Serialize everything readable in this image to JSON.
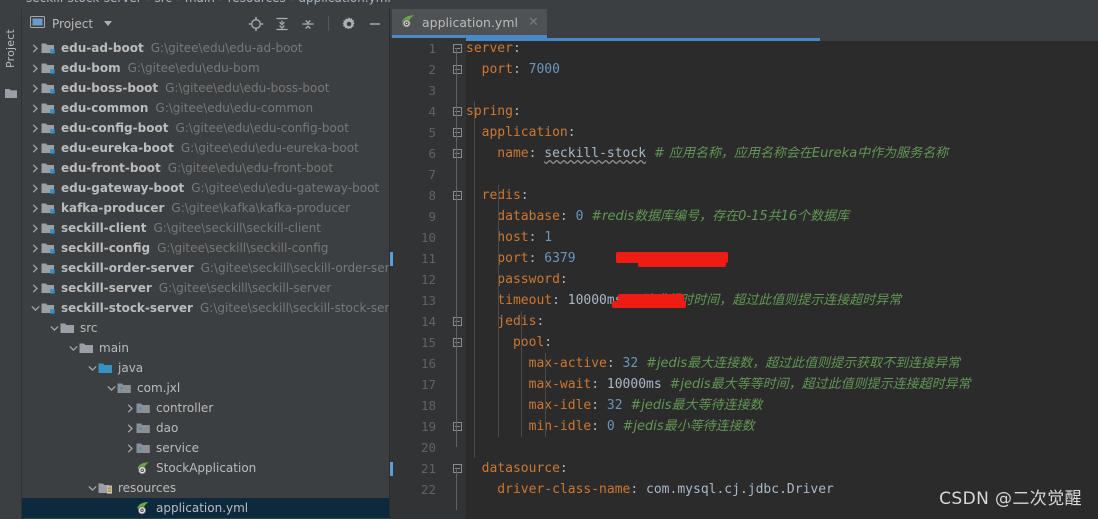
{
  "breadcrumb": {
    "items": [
      "seckill-stock-server",
      "src",
      "main",
      "resources"
    ],
    "file": "application.yml",
    "separator": "›"
  },
  "tool_strip": {
    "project_tab_label": "Project",
    "project_icon": "folder-icon"
  },
  "project_panel": {
    "title": "Project",
    "title_icon": "project-view-icon",
    "dropdown_icon": "chevron-down-icon",
    "tools": [
      {
        "name": "locate-icon",
        "label": "Select Opened File"
      },
      {
        "name": "expand-all-icon",
        "label": "Expand All"
      },
      {
        "name": "collapse-all-icon",
        "label": "Collapse All"
      },
      {
        "name": "gear-icon",
        "label": "Settings"
      },
      {
        "name": "minimize-icon",
        "label": "Hide"
      }
    ]
  },
  "tree": [
    {
      "indent": 0,
      "arrow": "right",
      "icon": "module-icon",
      "name": "edu-ad-boot",
      "path": "G:\\gitee\\edu\\edu-ad-boot",
      "bold": true
    },
    {
      "indent": 0,
      "arrow": "right",
      "icon": "module-icon",
      "name": "edu-bom",
      "path": "G:\\gitee\\edu\\edu-bom",
      "bold": true
    },
    {
      "indent": 0,
      "arrow": "right",
      "icon": "module-icon",
      "name": "edu-boss-boot",
      "path": "G:\\gitee\\edu\\edu-boss-boot",
      "bold": true
    },
    {
      "indent": 0,
      "arrow": "right",
      "icon": "module-icon",
      "name": "edu-common",
      "path": "G:\\gitee\\edu\\edu-common",
      "bold": true
    },
    {
      "indent": 0,
      "arrow": "right",
      "icon": "module-icon",
      "name": "edu-config-boot",
      "path": "G:\\gitee\\edu\\edu-config-boot",
      "bold": true
    },
    {
      "indent": 0,
      "arrow": "right",
      "icon": "module-icon",
      "name": "edu-eureka-boot",
      "path": "G:\\gitee\\edu\\edu-eureka-boot",
      "bold": true
    },
    {
      "indent": 0,
      "arrow": "right",
      "icon": "module-icon",
      "name": "edu-front-boot",
      "path": "G:\\gitee\\edu\\edu-front-boot",
      "bold": true
    },
    {
      "indent": 0,
      "arrow": "right",
      "icon": "module-icon",
      "name": "edu-gateway-boot",
      "path": "G:\\gitee\\edu\\edu-gateway-boot",
      "bold": true
    },
    {
      "indent": 0,
      "arrow": "right",
      "icon": "module-icon",
      "name": "kafka-producer",
      "path": "G:\\gitee\\kafka\\kafka-producer",
      "bold": true
    },
    {
      "indent": 0,
      "arrow": "right",
      "icon": "module-icon",
      "name": "seckill-client",
      "path": "G:\\gitee\\seckill\\seckill-client",
      "bold": true
    },
    {
      "indent": 0,
      "arrow": "right",
      "icon": "module-icon",
      "name": "seckill-config",
      "path": "G:\\gitee\\seckill\\seckill-config",
      "bold": true
    },
    {
      "indent": 0,
      "arrow": "right",
      "icon": "module-icon",
      "name": "seckill-order-server",
      "path": "G:\\gitee\\seckill\\seckill-order-server",
      "bold": true
    },
    {
      "indent": 0,
      "arrow": "right",
      "icon": "module-icon",
      "name": "seckill-server",
      "path": "G:\\gitee\\seckill\\seckill-server",
      "bold": true
    },
    {
      "indent": 0,
      "arrow": "down",
      "icon": "module-icon",
      "name": "seckill-stock-server",
      "path": "G:\\gitee\\seckill\\seckill-stock-server",
      "bold": true
    },
    {
      "indent": 1,
      "arrow": "down",
      "icon": "folder-icon",
      "name": "src",
      "path": "",
      "bold": false
    },
    {
      "indent": 2,
      "arrow": "down",
      "icon": "folder-icon",
      "name": "main",
      "path": "",
      "bold": false
    },
    {
      "indent": 3,
      "arrow": "down",
      "icon": "source-folder-icon",
      "name": "java",
      "path": "",
      "bold": false
    },
    {
      "indent": 4,
      "arrow": "down",
      "icon": "package-icon",
      "name": "com.jxl",
      "path": "",
      "bold": false
    },
    {
      "indent": 5,
      "arrow": "right",
      "icon": "package-icon",
      "name": "controller",
      "path": "",
      "bold": false
    },
    {
      "indent": 5,
      "arrow": "right",
      "icon": "package-icon",
      "name": "dao",
      "path": "",
      "bold": false
    },
    {
      "indent": 5,
      "arrow": "right",
      "icon": "package-icon",
      "name": "service",
      "path": "",
      "bold": false
    },
    {
      "indent": 5,
      "arrow": "none",
      "icon": "spring-class-icon",
      "name": "StockApplication",
      "path": "",
      "bold": false
    },
    {
      "indent": 3,
      "arrow": "down",
      "icon": "resources-folder-icon",
      "name": "resources",
      "path": "",
      "bold": false
    },
    {
      "indent": 5,
      "arrow": "none",
      "icon": "yml-spring-icon",
      "name": "application.yml",
      "path": "",
      "bold": false,
      "selected": true
    }
  ],
  "editor": {
    "tab": {
      "label": "application.yml",
      "icon": "yml-spring-icon",
      "close_icon": "close-icon"
    },
    "lines": [
      {
        "n": "1",
        "fold": "start",
        "segs": [
          {
            "t": "server",
            "c": "k"
          },
          {
            "t": ":",
            "c": "kk"
          }
        ]
      },
      {
        "n": "2",
        "fold": "end",
        "indent": 1,
        "segs": [
          {
            "t": "  port",
            "c": "k"
          },
          {
            "t": ": ",
            "c": "kk"
          },
          {
            "t": "7000",
            "c": "num"
          }
        ]
      },
      {
        "n": "3",
        "fold": "none",
        "segs": []
      },
      {
        "n": "4",
        "fold": "start",
        "segs": [
          {
            "t": "spring",
            "c": "k"
          },
          {
            "t": ":",
            "c": "kk"
          }
        ]
      },
      {
        "n": "5",
        "fold": "start",
        "indent": 1,
        "segs": [
          {
            "t": "  application",
            "c": "k"
          },
          {
            "t": ":",
            "c": "kk"
          }
        ]
      },
      {
        "n": "6",
        "fold": "end",
        "indent": 2,
        "segs": [
          {
            "t": "    name",
            "c": "k"
          },
          {
            "t": ": ",
            "c": "kk"
          },
          {
            "t": "seckill-stock",
            "c": "val",
            "squiggle": true
          },
          {
            "t": " ",
            "c": "kk"
          },
          {
            "t": "# 应用名称，应用名称会在Eureka中作为服务名称",
            "c": "cmx"
          }
        ]
      },
      {
        "n": "7",
        "fold": "none",
        "segs": []
      },
      {
        "n": "8",
        "fold": "start",
        "indent": 1,
        "segs": [
          {
            "t": "  redis",
            "c": "k"
          },
          {
            "t": ":",
            "c": "kk"
          }
        ]
      },
      {
        "n": "9",
        "fold": "none",
        "indent": 2,
        "segs": [
          {
            "t": "    database",
            "c": "k"
          },
          {
            "t": ": ",
            "c": "kk"
          },
          {
            "t": "0",
            "c": "num"
          },
          {
            "t": " ",
            "c": "kk"
          },
          {
            "t": "#redis数据库编号，存在0-15共16个数据库",
            "c": "cmx"
          }
        ]
      },
      {
        "n": "10",
        "fold": "none",
        "indent": 2,
        "segs": [
          {
            "t": "    host",
            "c": "k"
          },
          {
            "t": ": ",
            "c": "kk"
          },
          {
            "t": "1",
            "c": "num"
          }
        ],
        "redacted": "host"
      },
      {
        "n": "11",
        "fold": "none",
        "indent": 2,
        "segs": [
          {
            "t": "    port",
            "c": "k"
          },
          {
            "t": ": ",
            "c": "kk"
          },
          {
            "t": "6379",
            "c": "num"
          }
        ]
      },
      {
        "n": "12",
        "fold": "none",
        "indent": 2,
        "segs": [
          {
            "t": "    password",
            "c": "k"
          },
          {
            "t": ": ",
            "c": "kk"
          }
        ],
        "redacted": "password"
      },
      {
        "n": "13",
        "fold": "none",
        "indent": 2,
        "segs": [
          {
            "t": "    timeout",
            "c": "k"
          },
          {
            "t": ": ",
            "c": "kk"
          },
          {
            "t": "10000ms",
            "c": "val"
          },
          {
            "t": " ",
            "c": "kk"
          },
          {
            "t": "#请求超时时间，超过此值则提示连接超时异常",
            "c": "cmx"
          }
        ]
      },
      {
        "n": "14",
        "fold": "start",
        "indent": 2,
        "segs": [
          {
            "t": "    jedis",
            "c": "k"
          },
          {
            "t": ":",
            "c": "kk"
          }
        ]
      },
      {
        "n": "15",
        "fold": "start",
        "indent": 3,
        "segs": [
          {
            "t": "      pool",
            "c": "k"
          },
          {
            "t": ":",
            "c": "kk"
          }
        ]
      },
      {
        "n": "16",
        "fold": "none",
        "indent": 4,
        "segs": [
          {
            "t": "        max-active",
            "c": "k"
          },
          {
            "t": ": ",
            "c": "kk"
          },
          {
            "t": "32",
            "c": "num"
          },
          {
            "t": " ",
            "c": "kk"
          },
          {
            "t": "#jedis最大连接数，超过此值则提示获取不到连接异常",
            "c": "cmx"
          }
        ]
      },
      {
        "n": "17",
        "fold": "none",
        "indent": 4,
        "segs": [
          {
            "t": "        max-wait",
            "c": "k"
          },
          {
            "t": ": ",
            "c": "kk"
          },
          {
            "t": "10000ms",
            "c": "val"
          },
          {
            "t": " ",
            "c": "kk"
          },
          {
            "t": "#jedis最大等等时间，超过此值则提示连接超时异常",
            "c": "cmx"
          }
        ]
      },
      {
        "n": "18",
        "fold": "none",
        "indent": 4,
        "segs": [
          {
            "t": "        max-idle",
            "c": "k"
          },
          {
            "t": ": ",
            "c": "kk"
          },
          {
            "t": "32",
            "c": "num"
          },
          {
            "t": " ",
            "c": "kk"
          },
          {
            "t": "#jedis最大等待连接数",
            "c": "cmx"
          }
        ]
      },
      {
        "n": "19",
        "fold": "end",
        "indent": 4,
        "segs": [
          {
            "t": "        min-idle",
            "c": "k"
          },
          {
            "t": ": ",
            "c": "kk"
          },
          {
            "t": "0",
            "c": "num"
          },
          {
            "t": " ",
            "c": "kk"
          },
          {
            "t": "#jedis最小等待连接数",
            "c": "cmx"
          }
        ]
      },
      {
        "n": "20",
        "fold": "none",
        "segs": []
      },
      {
        "n": "21",
        "fold": "start",
        "indent": 1,
        "segs": [
          {
            "t": "  datasource",
            "c": "k"
          },
          {
            "t": ":",
            "c": "kk"
          }
        ]
      },
      {
        "n": "22",
        "fold": "none",
        "indent": 2,
        "segs": [
          {
            "t": "    driver-class-name",
            "c": "k"
          },
          {
            "t": ": ",
            "c": "kk"
          },
          {
            "t": "com.mysql.cj.jdbc.Driver",
            "c": "val"
          }
        ]
      }
    ]
  },
  "watermark": "CSDN @二次觉醒",
  "colors": {
    "panel_bg": "#3c3f41",
    "editor_bg": "#2b2b2b",
    "gutter_bg": "#313335",
    "selection": "#0d293e",
    "accent": "#4a88c7",
    "key": "#cc7832",
    "number": "#6897bb",
    "comment": "#629755",
    "value": "#a9b7c6",
    "redaction": "#ee1c13"
  }
}
